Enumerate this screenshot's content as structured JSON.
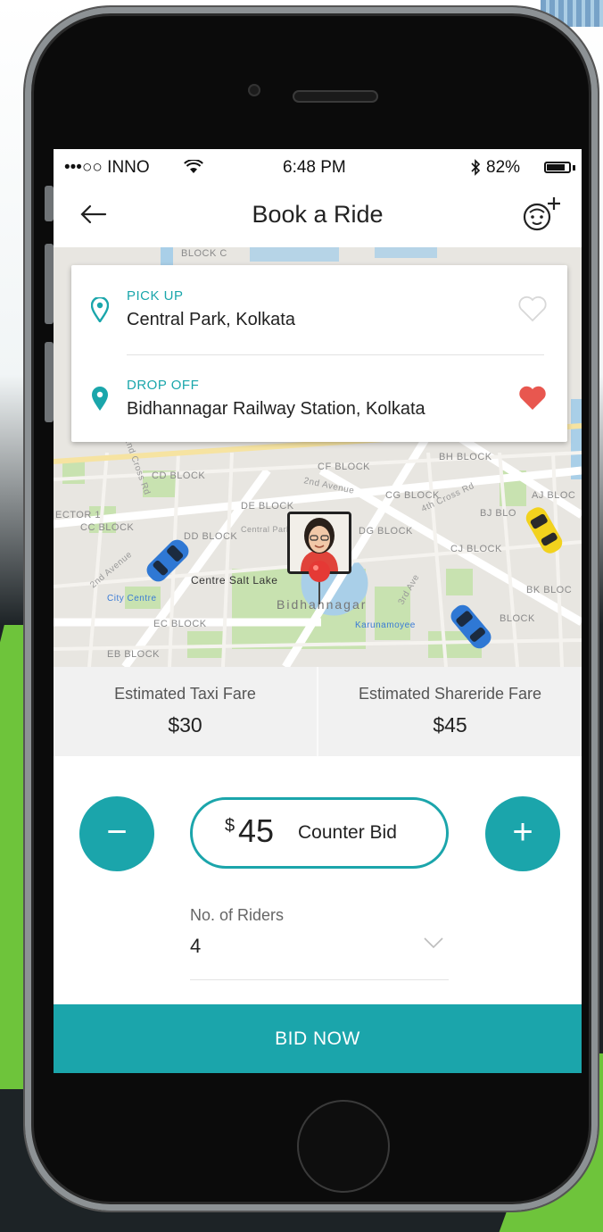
{
  "status_bar": {
    "carrier": "•••○○ INNO",
    "time": "6:48 PM",
    "battery": "82%",
    "battery_level": 0.82
  },
  "header": {
    "title": "Book a Ride"
  },
  "locations": {
    "pickup_label": "PICK UP",
    "pickup_value": "Central Park, Kolkata",
    "dropoff_label": "DROP OFF",
    "dropoff_value": "Bidhannagar Railway Station, Kolkata",
    "pickup_favorite": false,
    "dropoff_favorite": true
  },
  "map": {
    "labels": {
      "block_c": "BLOCK C",
      "cf_block": "CF BLOCK",
      "bh_block": "BH BLOCK",
      "cd_block": "CD BLOCK",
      "de_block": "DE BLOCK",
      "cg_block": "CG BLOCK",
      "aj_block": "AJ BLOC",
      "dd_block": "DD BLOCK",
      "dg_block": "DG BLOCK",
      "bj_block": "BJ BLO",
      "cj_block": "CJ BLOCK",
      "cc_block": "CC BLOCK",
      "sector1": "ECTOR 1",
      "bk_block": "BK BLOC",
      "ec_block": "EC BLOCK",
      "eb_block": "EB BLOCK",
      "block_right": "BLOCK",
      "centre_salt_lake": "Centre Salt Lake",
      "city_centre": "City Centre",
      "bidhannagar": "Bidhannagar",
      "karunamoyee": "Karunamoyee",
      "2nd_avenue": "2nd Avenue",
      "3rd_ave": "3rd Ave",
      "2nd_cross": "2nd Cross Rd",
      "4th_cross": "4th Cross Rd",
      "central_park_road": "Central Park"
    }
  },
  "fares": {
    "taxi_label": "Estimated Taxi Fare",
    "taxi_value": "$30",
    "shareride_label": "Estimated Shareride Fare",
    "shareride_value": "$45"
  },
  "bid": {
    "currency": "$",
    "amount": "45",
    "label": "Counter Bid",
    "minus": "−",
    "plus": "+"
  },
  "riders": {
    "label": "No. of Riders",
    "value": "4"
  },
  "bid_now": "BID NOW",
  "colors": {
    "accent": "#1ba5ab",
    "heart": "#e8574f",
    "pin": "#e53935"
  }
}
